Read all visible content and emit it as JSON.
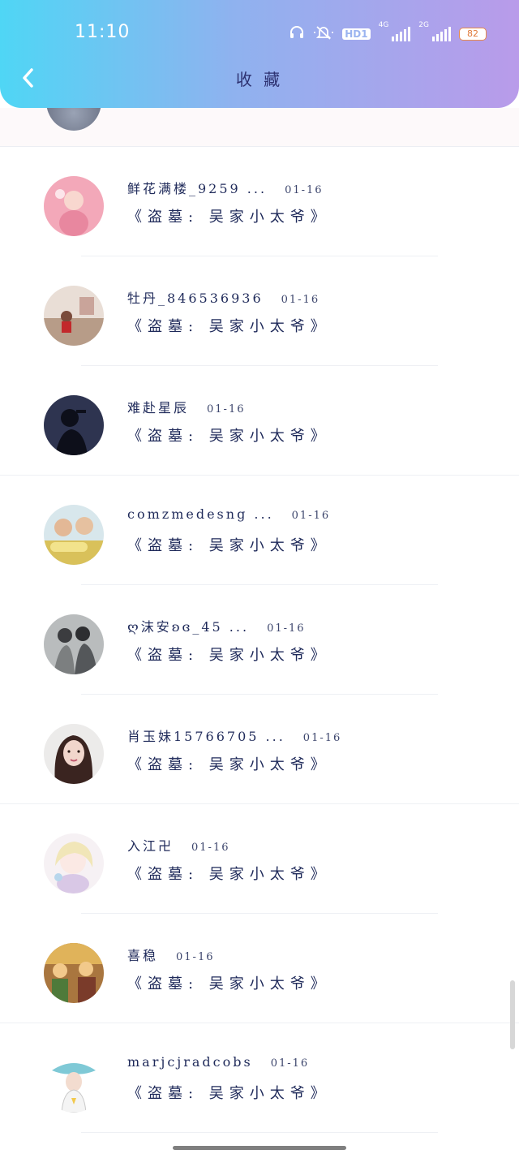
{
  "status_bar": {
    "time": "11:10",
    "hd_label": "HD1",
    "net1_label": "4G",
    "net2_label": "2G",
    "battery": "82"
  },
  "header": {
    "title": "收 藏"
  },
  "items": [
    {
      "name": "鲜花满楼_9259 ...",
      "date": "01-16",
      "collection": "《盗墓: 吴家小太爷》"
    },
    {
      "name": "牡丹_846536936",
      "date": "01-16",
      "collection": "《盗墓: 吴家小太爷》"
    },
    {
      "name": "难赴星辰",
      "date": "01-16",
      "collection": "《盗墓: 吴家小太爷》"
    },
    {
      "name": "comzmedesng ...",
      "date": "01-16",
      "collection": "《盗墓: 吴家小太爷》"
    },
    {
      "name": "ღ沫安ʚɞ_45 ...",
      "date": "01-16",
      "collection": "《盗墓: 吴家小太爷》"
    },
    {
      "name": "肖玉妹15766705 ...",
      "date": "01-16",
      "collection": "《盗墓: 吴家小太爷》"
    },
    {
      "name": "入江卍",
      "date": "01-16",
      "collection": "《盗墓: 吴家小太爷》"
    },
    {
      "name": "喜稳",
      "date": "01-16",
      "collection": "《盗墓: 吴家小太爷》"
    },
    {
      "name": "marjcjradcobs",
      "date": "01-16",
      "collection": "《盗墓: 吴家小太爷》"
    }
  ],
  "avatar_colors": [
    "#f3a8b9",
    "#c9a49a",
    "#2e3450",
    "#d9c15a",
    "#7c7f80",
    "#5a3a33",
    "#f1e6ef",
    "#a9763f",
    "#e7f2f5"
  ],
  "accent": {
    "header_start": "#4fd6f5",
    "header_end": "#b99bea",
    "text": "#1f2a5a"
  }
}
